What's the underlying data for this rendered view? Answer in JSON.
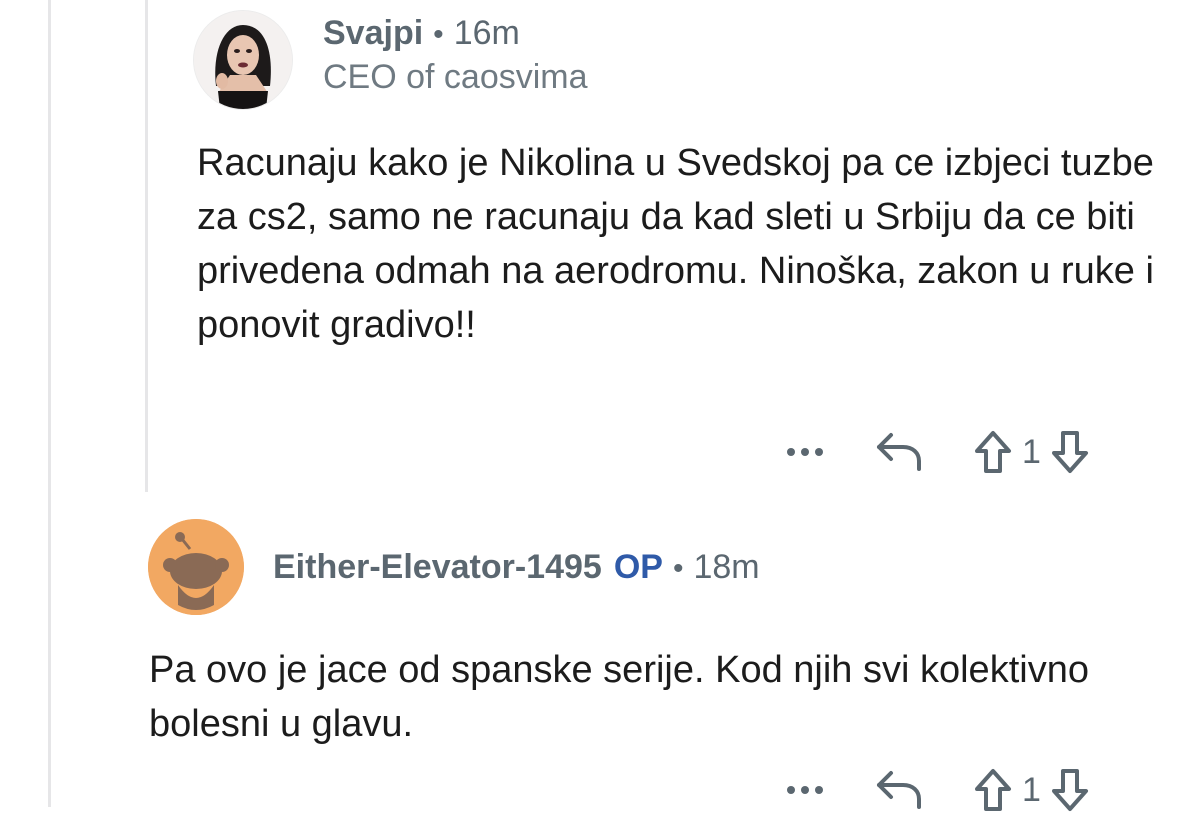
{
  "comment_1": {
    "username": "Svajpi",
    "separator": "•",
    "time": "16m",
    "flair": "CEO of caosvima",
    "body": "Racunaju kako je Nikolina u Svedskoj pa ce izbjeci tuzbe za cs2, samo ne racunaju da kad sleti u Srbiju da ce biti privedena odmah na aerodromu. Ninoška, zakon u ruke i ponovit gradivo!!",
    "score": "1",
    "icons": [
      "more-icon",
      "reply-icon",
      "upvote-icon",
      "downvote-icon"
    ]
  },
  "comment_2": {
    "username": "Either-Elevator-1495",
    "op_badge": "OP",
    "separator": "•",
    "time": "18m",
    "body": "Pa ovo je jace od spanske serije. Kod njih svi kolektivno bolesni u glavu.",
    "score": "1",
    "icons": [
      "more-icon",
      "reply-icon",
      "upvote-icon",
      "downvote-icon"
    ]
  },
  "colors": {
    "meta_text": "#5b6770",
    "op_badge": "#2f5aa8",
    "body_text": "#1c1c1c",
    "thread_line": "#e6e6e8",
    "default_avatar_bg": "#f2a862"
  }
}
